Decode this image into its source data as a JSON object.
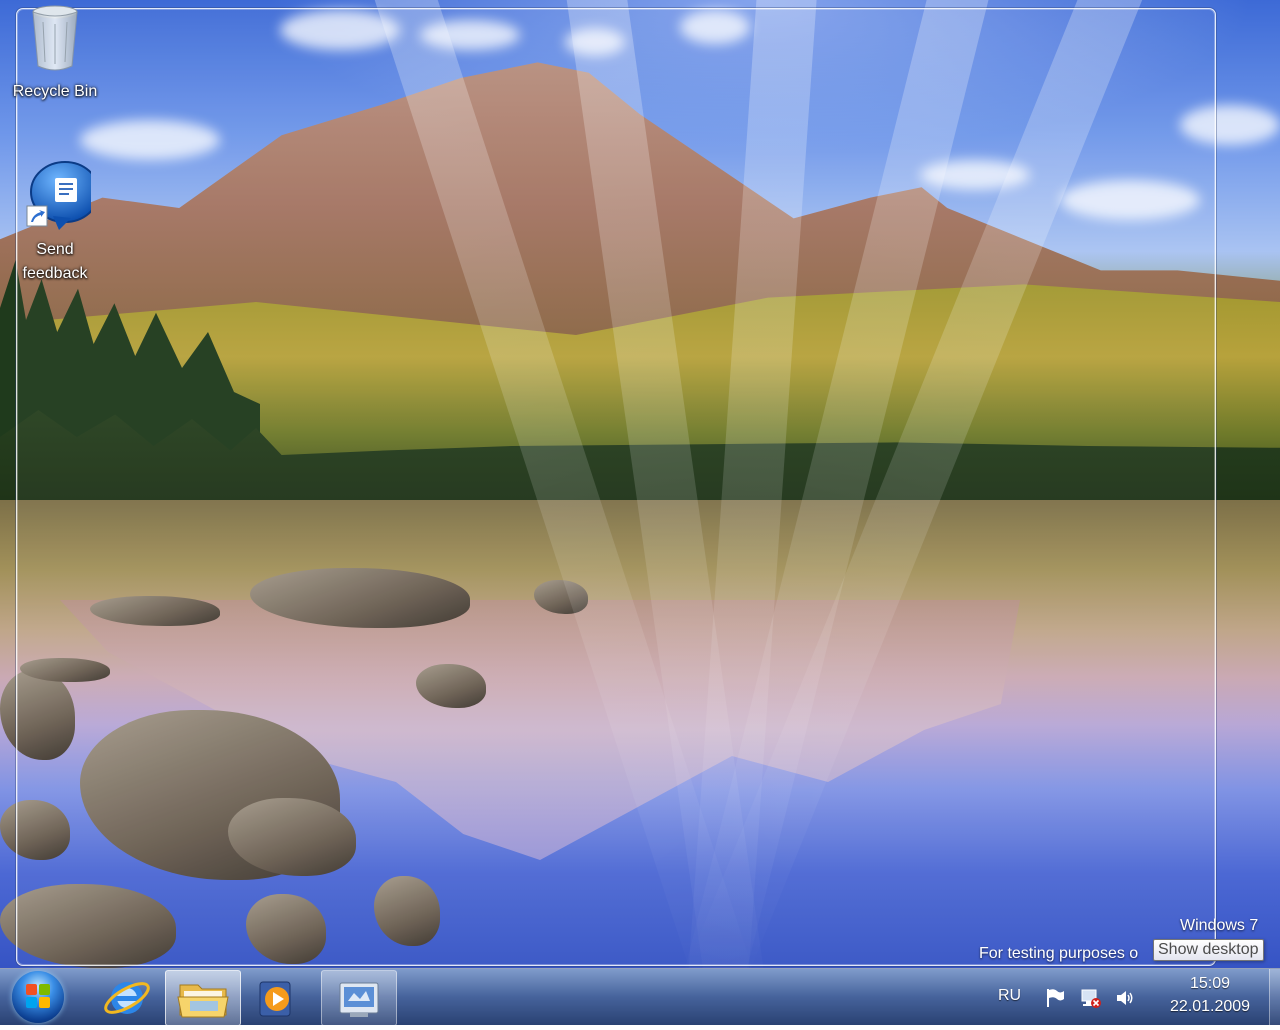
{
  "desktop": {
    "icons": [
      {
        "label": "Recycle Bin",
        "icon": "recycle-bin-icon"
      },
      {
        "label": "Send feedback",
        "icon": "send-feedback-icon"
      }
    ],
    "watermark": {
      "line1": "Windows  7",
      "line2": "For testing purposes o"
    },
    "tooltip": "Show desktop"
  },
  "taskbar": {
    "start_icon": "windows-start-orb-icon",
    "pinned": [
      {
        "name": "internet-explorer",
        "icon": "internet-explorer-icon",
        "state": "pinned"
      },
      {
        "name": "windows-explorer",
        "icon": "folder-icon",
        "state": "active"
      },
      {
        "name": "media-player",
        "icon": "media-player-icon",
        "state": "pinned"
      },
      {
        "name": "control-panel",
        "icon": "control-panel-icon",
        "state": "running"
      }
    ],
    "tray": {
      "language": "RU",
      "icons": [
        "action-center-flag-icon",
        "network-disconnected-icon",
        "volume-icon"
      ],
      "time": "15:09",
      "date": "22.01.2009"
    }
  },
  "colors": {
    "taskbar": "#3c5a96",
    "accent": "#3a8ee6"
  }
}
